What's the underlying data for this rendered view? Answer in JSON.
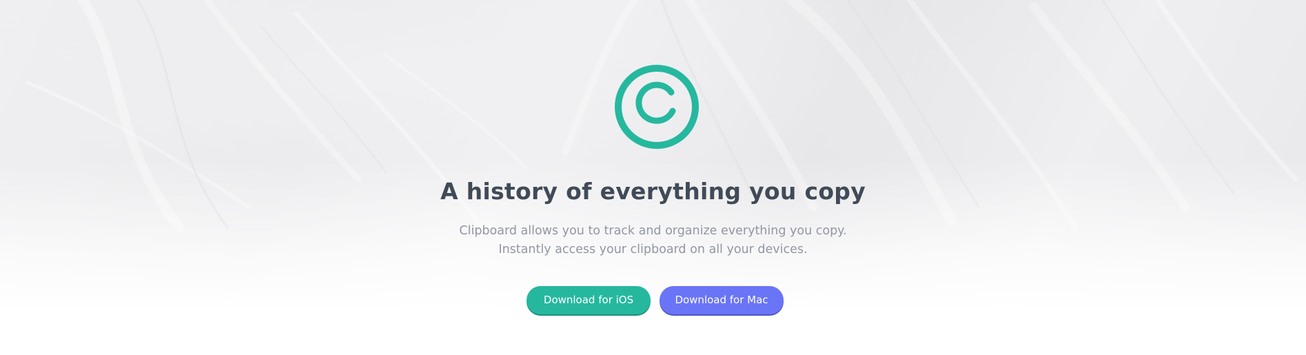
{
  "hero": {
    "headline": "A history of everything you copy",
    "subtext": "Clipboard allows you to track and organize everything you copy. Instantly access your clipboard on all your devices.",
    "logo_icon": "copyright-icon"
  },
  "buttons": {
    "ios_label": "Download for iOS",
    "mac_label": "Download for Mac"
  },
  "colors": {
    "accent_green": "#26b89f",
    "accent_blue": "#6a74f6",
    "headline": "#414a57",
    "body_text": "#9097a3"
  }
}
